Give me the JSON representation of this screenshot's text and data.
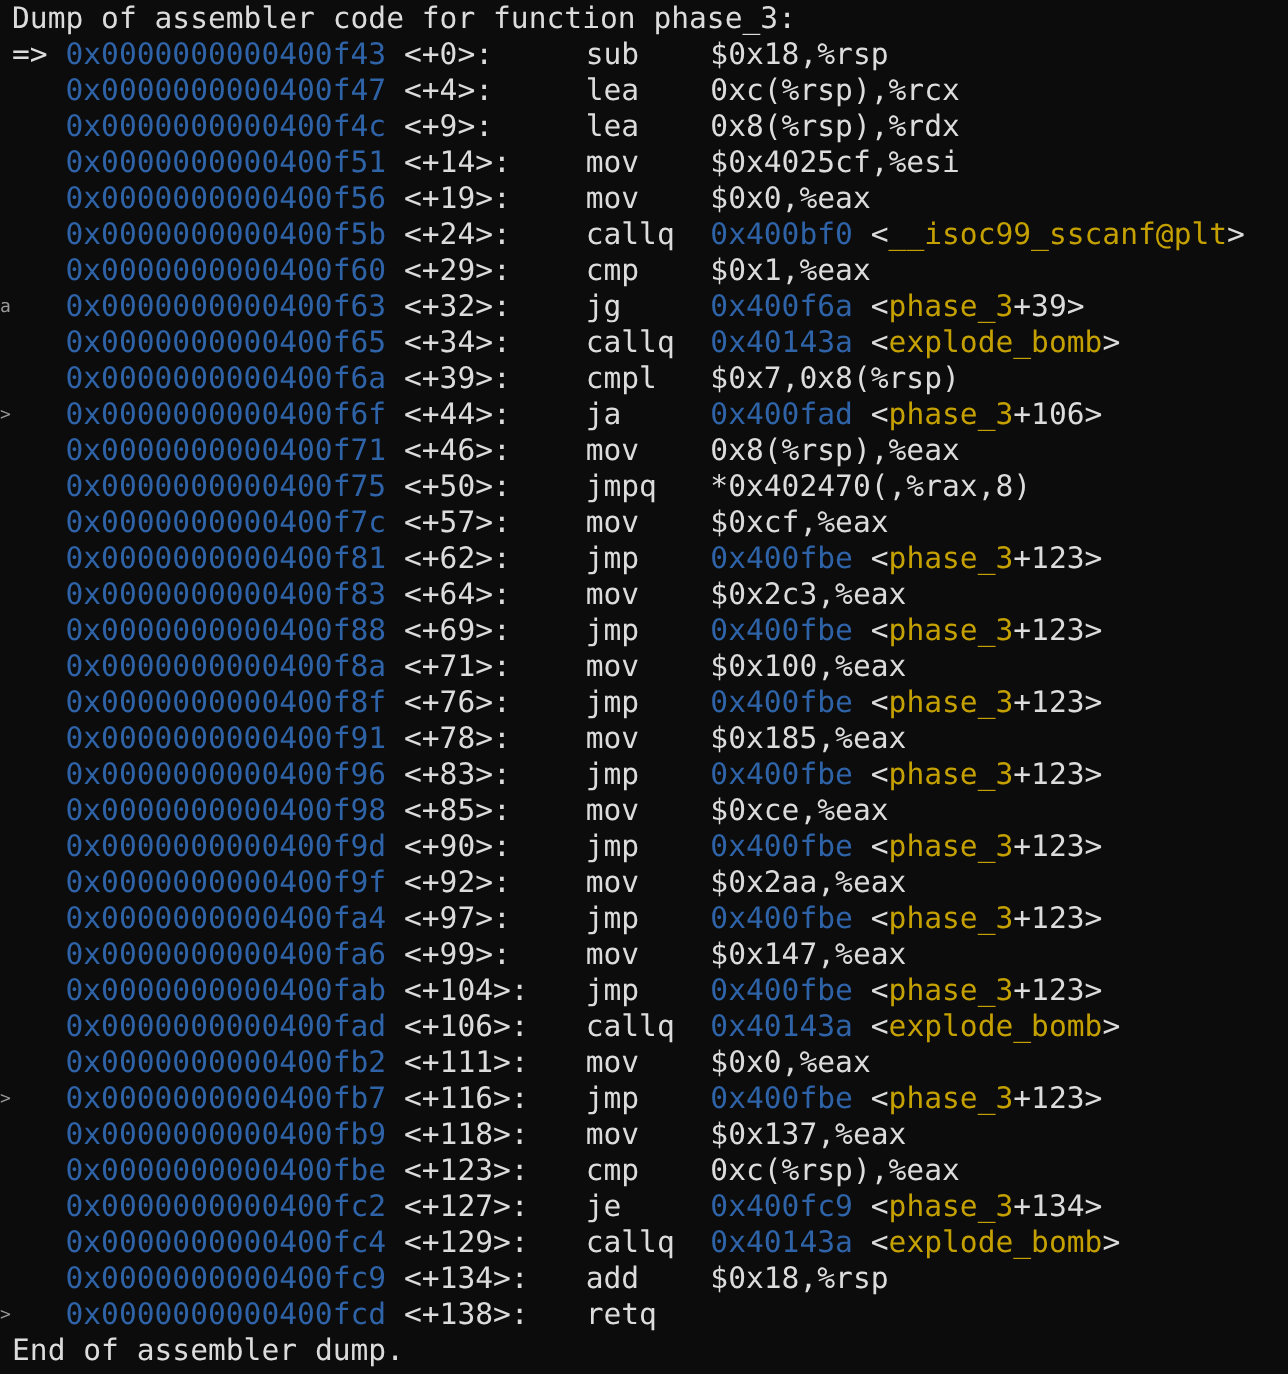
{
  "header": "Dump of assembler code for function phase_3:",
  "current_marker": "=>",
  "rows": [
    {
      "current": true,
      "address": "0x0000000000400f43",
      "offset": "<+0>:",
      "mnemonic": "sub",
      "operand": [
        {
          "kind": "plain",
          "text": "$0x18,%rsp"
        }
      ]
    },
    {
      "current": false,
      "address": "0x0000000000400f47",
      "offset": "<+4>:",
      "mnemonic": "lea",
      "operand": [
        {
          "kind": "plain",
          "text": "0xc(%rsp),%rcx"
        }
      ]
    },
    {
      "current": false,
      "address": "0x0000000000400f4c",
      "offset": "<+9>:",
      "mnemonic": "lea",
      "operand": [
        {
          "kind": "plain",
          "text": "0x8(%rsp),%rdx"
        }
      ]
    },
    {
      "current": false,
      "address": "0x0000000000400f51",
      "offset": "<+14>:",
      "mnemonic": "mov",
      "operand": [
        {
          "kind": "plain",
          "text": "$0x4025cf,%esi"
        }
      ]
    },
    {
      "current": false,
      "address": "0x0000000000400f56",
      "offset": "<+19>:",
      "mnemonic": "mov",
      "operand": [
        {
          "kind": "plain",
          "text": "$0x0,%eax"
        }
      ]
    },
    {
      "current": false,
      "address": "0x0000000000400f5b",
      "offset": "<+24>:",
      "mnemonic": "callq",
      "operand": [
        {
          "kind": "address",
          "text": "0x400bf0"
        },
        {
          "kind": "plain",
          "text": " <"
        },
        {
          "kind": "symbol",
          "text": "__isoc99_sscanf@plt"
        },
        {
          "kind": "plain",
          "text": ">"
        }
      ]
    },
    {
      "current": false,
      "address": "0x0000000000400f60",
      "offset": "<+29>:",
      "mnemonic": "cmp",
      "operand": [
        {
          "kind": "plain",
          "text": "$0x1,%eax"
        }
      ]
    },
    {
      "current": false,
      "gutter": "a",
      "address": "0x0000000000400f63",
      "offset": "<+32>:",
      "mnemonic": "jg",
      "operand": [
        {
          "kind": "address",
          "text": "0x400f6a"
        },
        {
          "kind": "plain",
          "text": " <"
        },
        {
          "kind": "symbol",
          "text": "phase_3"
        },
        {
          "kind": "plain",
          "text": "+39>"
        }
      ]
    },
    {
      "current": false,
      "address": "0x0000000000400f65",
      "offset": "<+34>:",
      "mnemonic": "callq",
      "operand": [
        {
          "kind": "address",
          "text": "0x40143a"
        },
        {
          "kind": "plain",
          "text": " <"
        },
        {
          "kind": "symbol",
          "text": "explode_bomb"
        },
        {
          "kind": "plain",
          "text": ">"
        }
      ]
    },
    {
      "current": false,
      "address": "0x0000000000400f6a",
      "offset": "<+39>:",
      "mnemonic": "cmpl",
      "operand": [
        {
          "kind": "plain",
          "text": "$0x7,0x8(%rsp)"
        }
      ]
    },
    {
      "current": false,
      "gutter": ">",
      "address": "0x0000000000400f6f",
      "offset": "<+44>:",
      "mnemonic": "ja",
      "operand": [
        {
          "kind": "address",
          "text": "0x400fad"
        },
        {
          "kind": "plain",
          "text": " <"
        },
        {
          "kind": "symbol",
          "text": "phase_3"
        },
        {
          "kind": "plain",
          "text": "+106>"
        }
      ]
    },
    {
      "current": false,
      "address": "0x0000000000400f71",
      "offset": "<+46>:",
      "mnemonic": "mov",
      "operand": [
        {
          "kind": "plain",
          "text": "0x8(%rsp),%eax"
        }
      ]
    },
    {
      "current": false,
      "address": "0x0000000000400f75",
      "offset": "<+50>:",
      "mnemonic": "jmpq",
      "operand": [
        {
          "kind": "plain",
          "text": "*0x402470(,%rax,8)"
        }
      ]
    },
    {
      "current": false,
      "address": "0x0000000000400f7c",
      "offset": "<+57>:",
      "mnemonic": "mov",
      "operand": [
        {
          "kind": "plain",
          "text": "$0xcf,%eax"
        }
      ]
    },
    {
      "current": false,
      "address": "0x0000000000400f81",
      "offset": "<+62>:",
      "mnemonic": "jmp",
      "operand": [
        {
          "kind": "address",
          "text": "0x400fbe"
        },
        {
          "kind": "plain",
          "text": " <"
        },
        {
          "kind": "symbol",
          "text": "phase_3"
        },
        {
          "kind": "plain",
          "text": "+123>"
        }
      ]
    },
    {
      "current": false,
      "address": "0x0000000000400f83",
      "offset": "<+64>:",
      "mnemonic": "mov",
      "operand": [
        {
          "kind": "plain",
          "text": "$0x2c3,%eax"
        }
      ]
    },
    {
      "current": false,
      "address": "0x0000000000400f88",
      "offset": "<+69>:",
      "mnemonic": "jmp",
      "operand": [
        {
          "kind": "address",
          "text": "0x400fbe"
        },
        {
          "kind": "plain",
          "text": " <"
        },
        {
          "kind": "symbol",
          "text": "phase_3"
        },
        {
          "kind": "plain",
          "text": "+123>"
        }
      ]
    },
    {
      "current": false,
      "address": "0x0000000000400f8a",
      "offset": "<+71>:",
      "mnemonic": "mov",
      "operand": [
        {
          "kind": "plain",
          "text": "$0x100,%eax"
        }
      ]
    },
    {
      "current": false,
      "address": "0x0000000000400f8f",
      "offset": "<+76>:",
      "mnemonic": "jmp",
      "operand": [
        {
          "kind": "address",
          "text": "0x400fbe"
        },
        {
          "kind": "plain",
          "text": " <"
        },
        {
          "kind": "symbol",
          "text": "phase_3"
        },
        {
          "kind": "plain",
          "text": "+123>"
        }
      ]
    },
    {
      "current": false,
      "address": "0x0000000000400f91",
      "offset": "<+78>:",
      "mnemonic": "mov",
      "operand": [
        {
          "kind": "plain",
          "text": "$0x185,%eax"
        }
      ]
    },
    {
      "current": false,
      "address": "0x0000000000400f96",
      "offset": "<+83>:",
      "mnemonic": "jmp",
      "operand": [
        {
          "kind": "address",
          "text": "0x400fbe"
        },
        {
          "kind": "plain",
          "text": " <"
        },
        {
          "kind": "symbol",
          "text": "phase_3"
        },
        {
          "kind": "plain",
          "text": "+123>"
        }
      ]
    },
    {
      "current": false,
      "address": "0x0000000000400f98",
      "offset": "<+85>:",
      "mnemonic": "mov",
      "operand": [
        {
          "kind": "plain",
          "text": "$0xce,%eax"
        }
      ]
    },
    {
      "current": false,
      "address": "0x0000000000400f9d",
      "offset": "<+90>:",
      "mnemonic": "jmp",
      "operand": [
        {
          "kind": "address",
          "text": "0x400fbe"
        },
        {
          "kind": "plain",
          "text": " <"
        },
        {
          "kind": "symbol",
          "text": "phase_3"
        },
        {
          "kind": "plain",
          "text": "+123>"
        }
      ]
    },
    {
      "current": false,
      "address": "0x0000000000400f9f",
      "offset": "<+92>:",
      "mnemonic": "mov",
      "operand": [
        {
          "kind": "plain",
          "text": "$0x2aa,%eax"
        }
      ]
    },
    {
      "current": false,
      "address": "0x0000000000400fa4",
      "offset": "<+97>:",
      "mnemonic": "jmp",
      "operand": [
        {
          "kind": "address",
          "text": "0x400fbe"
        },
        {
          "kind": "plain",
          "text": " <"
        },
        {
          "kind": "symbol",
          "text": "phase_3"
        },
        {
          "kind": "plain",
          "text": "+123>"
        }
      ]
    },
    {
      "current": false,
      "address": "0x0000000000400fa6",
      "offset": "<+99>:",
      "mnemonic": "mov",
      "operand": [
        {
          "kind": "plain",
          "text": "$0x147,%eax"
        }
      ]
    },
    {
      "current": false,
      "address": "0x0000000000400fab",
      "offset": "<+104>:",
      "mnemonic": "jmp",
      "operand": [
        {
          "kind": "address",
          "text": "0x400fbe"
        },
        {
          "kind": "plain",
          "text": " <"
        },
        {
          "kind": "symbol",
          "text": "phase_3"
        },
        {
          "kind": "plain",
          "text": "+123>"
        }
      ]
    },
    {
      "current": false,
      "address": "0x0000000000400fad",
      "offset": "<+106>:",
      "mnemonic": "callq",
      "operand": [
        {
          "kind": "address",
          "text": "0x40143a"
        },
        {
          "kind": "plain",
          "text": " <"
        },
        {
          "kind": "symbol",
          "text": "explode_bomb"
        },
        {
          "kind": "plain",
          "text": ">"
        }
      ]
    },
    {
      "current": false,
      "address": "0x0000000000400fb2",
      "offset": "<+111>:",
      "mnemonic": "mov",
      "operand": [
        {
          "kind": "plain",
          "text": "$0x0,%eax"
        }
      ]
    },
    {
      "current": false,
      "gutter": ">",
      "address": "0x0000000000400fb7",
      "offset": "<+116>:",
      "mnemonic": "jmp",
      "operand": [
        {
          "kind": "address",
          "text": "0x400fbe"
        },
        {
          "kind": "plain",
          "text": " <"
        },
        {
          "kind": "symbol",
          "text": "phase_3"
        },
        {
          "kind": "plain",
          "text": "+123>"
        }
      ]
    },
    {
      "current": false,
      "address": "0x0000000000400fb9",
      "offset": "<+118>:",
      "mnemonic": "mov",
      "operand": [
        {
          "kind": "plain",
          "text": "$0x137,%eax"
        }
      ]
    },
    {
      "current": false,
      "address": "0x0000000000400fbe",
      "offset": "<+123>:",
      "mnemonic": "cmp",
      "operand": [
        {
          "kind": "plain",
          "text": "0xc(%rsp),%eax"
        }
      ]
    },
    {
      "current": false,
      "address": "0x0000000000400fc2",
      "offset": "<+127>:",
      "mnemonic": "je",
      "operand": [
        {
          "kind": "address",
          "text": "0x400fc9"
        },
        {
          "kind": "plain",
          "text": " <"
        },
        {
          "kind": "symbol",
          "text": "phase_3"
        },
        {
          "kind": "plain",
          "text": "+134>"
        }
      ]
    },
    {
      "current": false,
      "address": "0x0000000000400fc4",
      "offset": "<+129>:",
      "mnemonic": "callq",
      "operand": [
        {
          "kind": "address",
          "text": "0x40143a"
        },
        {
          "kind": "plain",
          "text": " <"
        },
        {
          "kind": "symbol",
          "text": "explode_bomb"
        },
        {
          "kind": "plain",
          "text": ">"
        }
      ]
    },
    {
      "current": false,
      "address": "0x0000000000400fc9",
      "offset": "<+134>:",
      "mnemonic": "add",
      "operand": [
        {
          "kind": "plain",
          "text": "$0x18,%rsp"
        }
      ]
    },
    {
      "current": false,
      "gutter": ">",
      "address": "0x0000000000400fcd",
      "offset": "<+138>:",
      "mnemonic": "retq"
    }
  ],
  "footer": "End of assembler dump."
}
